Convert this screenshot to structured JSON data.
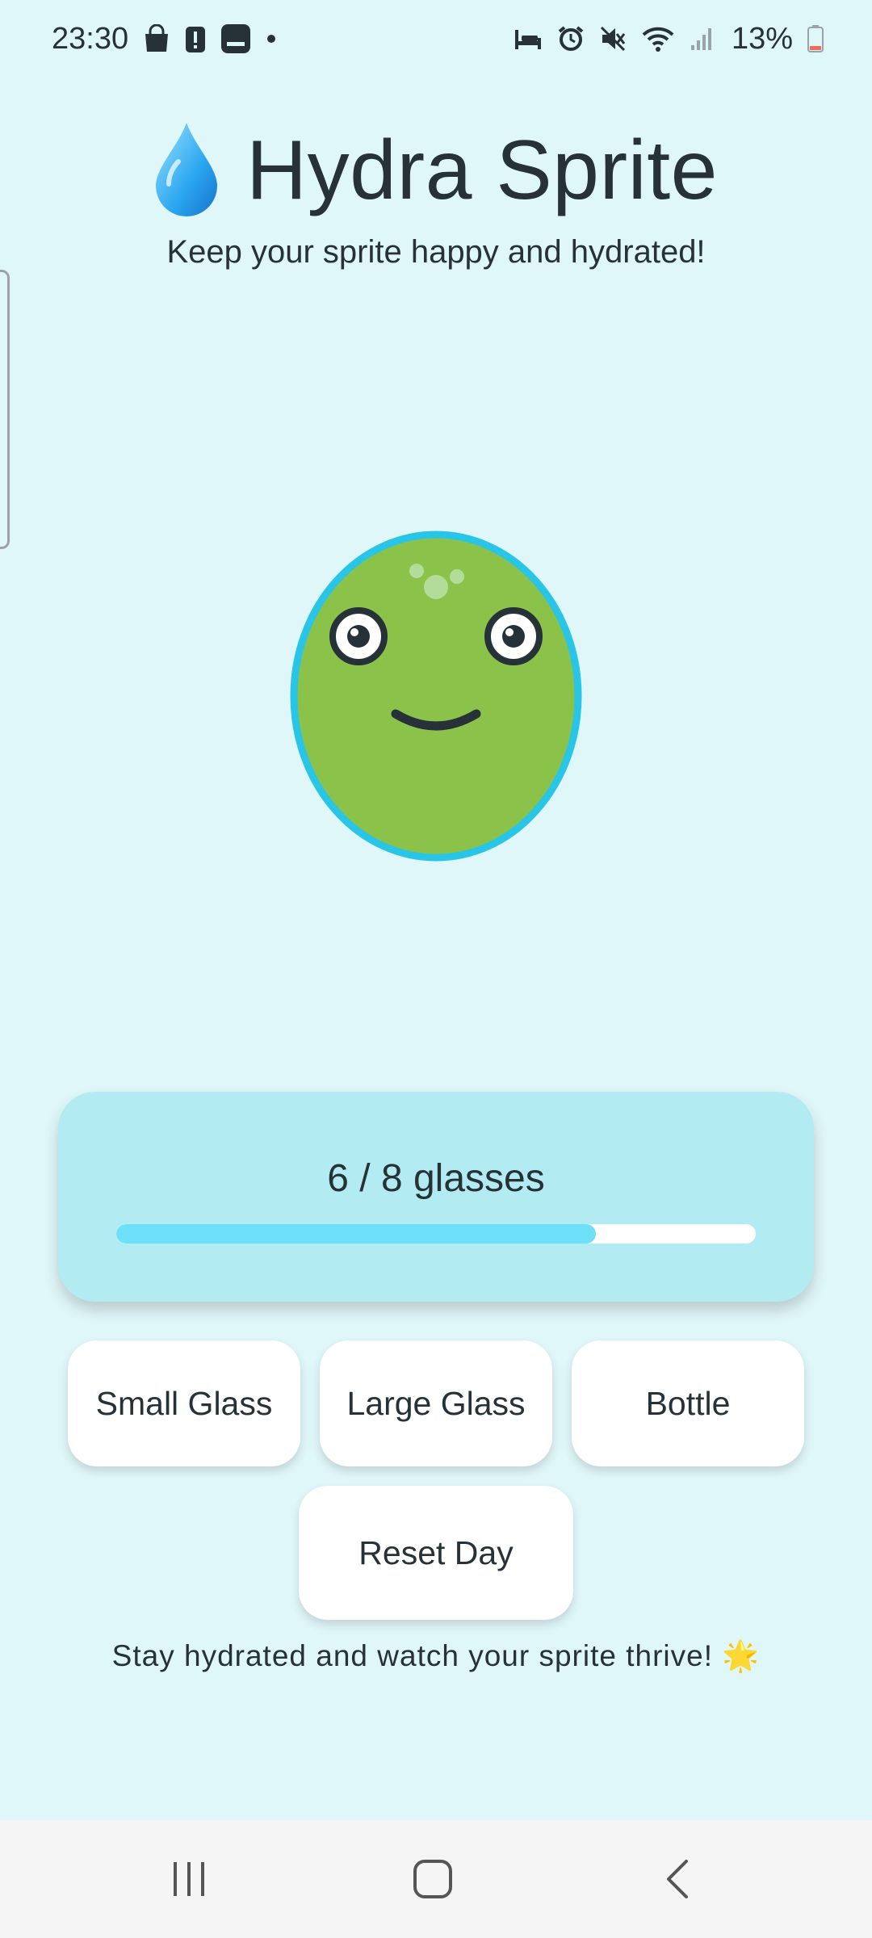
{
  "status_bar": {
    "time": "23:30",
    "battery_percent": "13%",
    "left_icons": [
      "shopping-bag-icon",
      "alert-icon",
      "media-icon",
      "dot-icon"
    ],
    "right_icons": [
      "bed-icon",
      "alarm-icon",
      "mute-icon",
      "wifi-icon",
      "signal-icon",
      "battery-icon"
    ]
  },
  "header": {
    "icon": "droplet-icon",
    "title": "Hydra Sprite",
    "subtitle": "Keep your sprite happy and hydrated!"
  },
  "sprite": {
    "body_color": "#8bc34a",
    "outline_color": "#29c5e6",
    "mood": "happy"
  },
  "progress": {
    "label": "6 / 8 glasses",
    "current": 6,
    "goal": 8,
    "fill_fraction": 0.75,
    "fill_color": "#6ee0f7"
  },
  "buttons": {
    "small_glass": "Small Glass",
    "large_glass": "Large Glass",
    "bottle": "Bottle",
    "reset_day": "Reset Day"
  },
  "footer": {
    "message": "Stay hydrated and watch your sprite thrive! 🌟"
  },
  "nav": {
    "icons": [
      "recent-apps-icon",
      "home-icon",
      "back-icon"
    ]
  },
  "colors": {
    "background": "#e0f7fa",
    "card": "#b2ebf2",
    "text": "#263238"
  }
}
